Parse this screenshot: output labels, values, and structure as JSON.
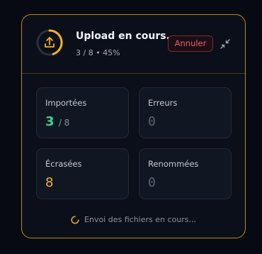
{
  "header": {
    "title": "Upload en cours...",
    "progress_text": "3 / 8 • 45%",
    "progress_fraction": 0.45,
    "cancel_label": "Annuler",
    "upload_icon": "upload-icon",
    "collapse_icon": "collapse-icon"
  },
  "stats": {
    "imported": {
      "label": "Importées",
      "value": "3",
      "total": "/ 8"
    },
    "errors": {
      "label": "Erreurs",
      "value": "0"
    },
    "overwritten": {
      "label": "Écrasées",
      "value": "8"
    },
    "renamed": {
      "label": "Renommées",
      "value": "0"
    }
  },
  "footer": {
    "status_text": "Envoi des fichiers en cours...",
    "spinner_icon": "spinner-icon"
  },
  "colors": {
    "accent": "#f0b31c",
    "success": "#3fd18b",
    "danger": "#f05a68",
    "background": "#0b0f19"
  }
}
